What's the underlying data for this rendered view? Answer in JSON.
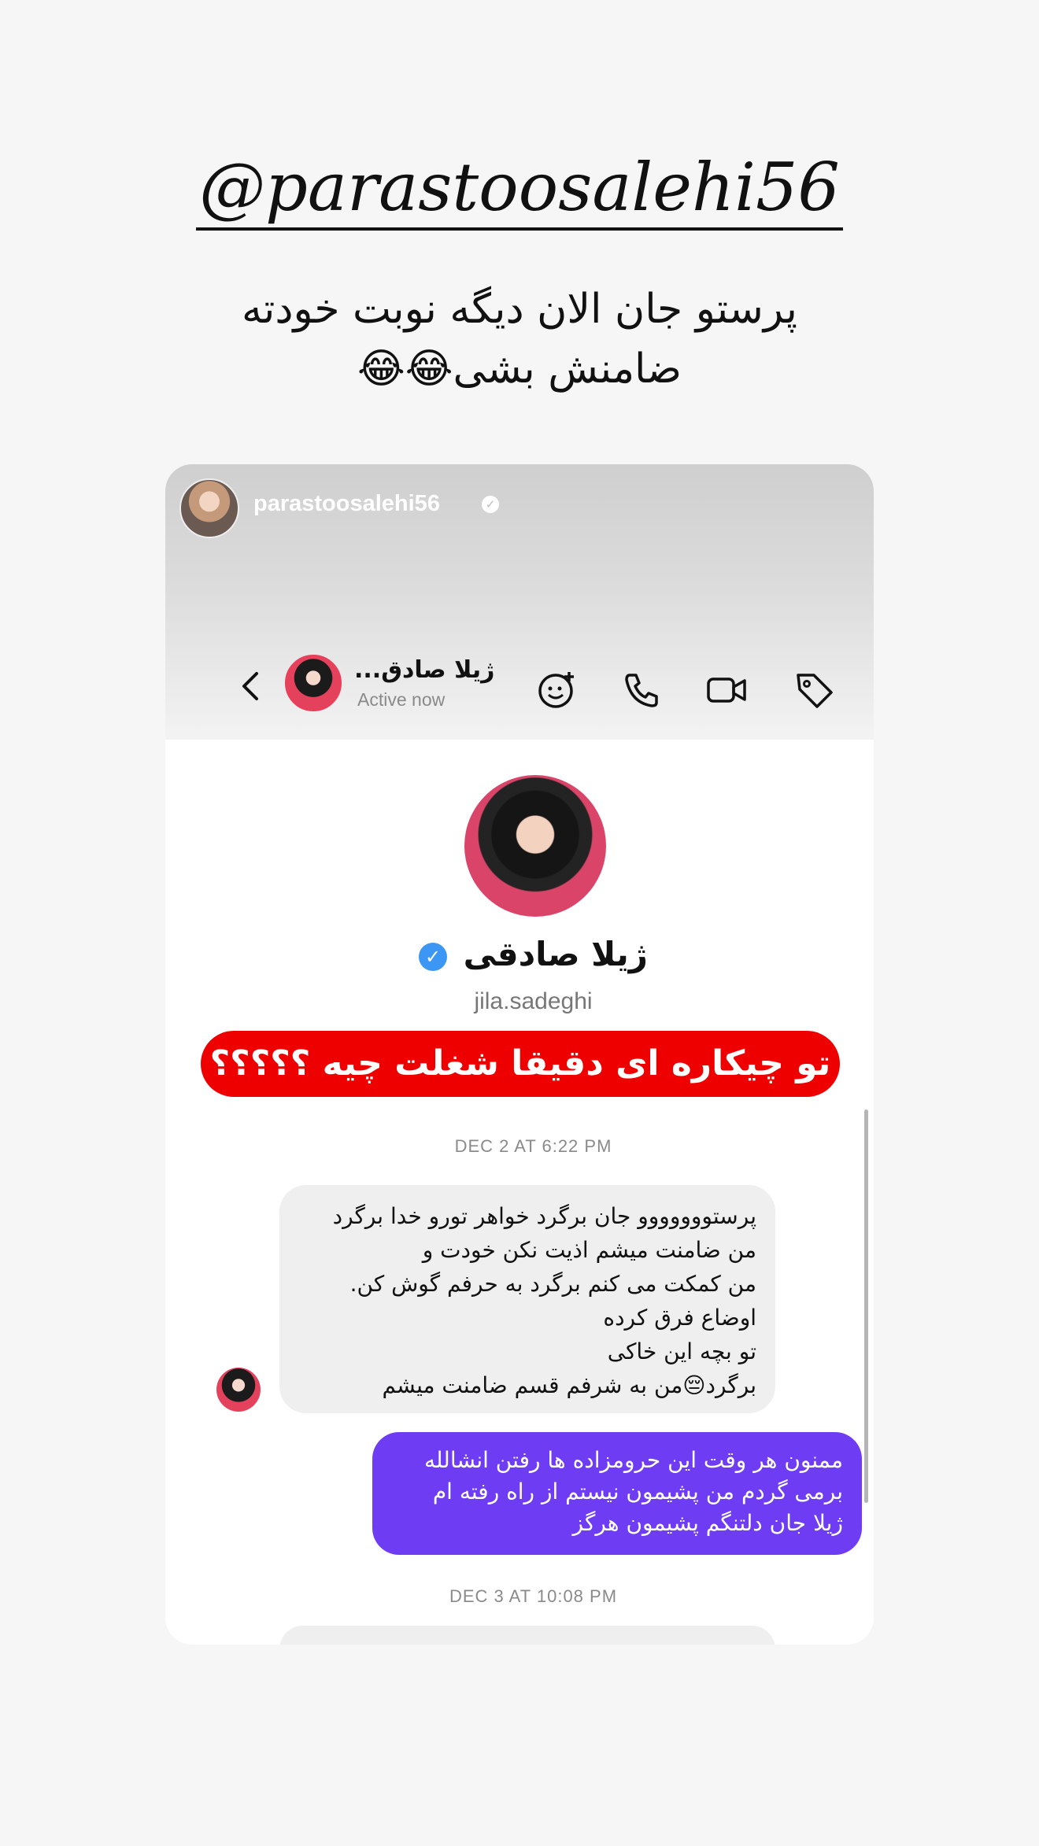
{
  "story": {
    "mention": "@parastoosalehi56",
    "caption_line1": "پرستو جان الان دیگه نوبت خودته",
    "caption_line2": "ضامنش بشی😂😂"
  },
  "shared_post": {
    "username": "parastoosalehi56",
    "verified_icon": "verified-check-icon"
  },
  "dm_header": {
    "contact_name": "ژیلا صادق...",
    "status": "Active now",
    "icons": [
      "back-chevron-icon",
      "add-sticker-icon",
      "phone-icon",
      "video-icon",
      "tag-icon"
    ]
  },
  "profile": {
    "name": "ژیلا صادقی",
    "verified_glyph": "✓",
    "handle": "jila.sadeghi"
  },
  "banner": {
    "text": "تو چیکاره ای دقیقا شغلت چیه ؟؟؟؟؟",
    "color": "#ef0000"
  },
  "messages": {
    "timestamp_1": "DEC 2 AT 6:22 PM",
    "received_lines": [
      "پرستووووووو جان برگرد خواهر تورو خدا برگرد",
      "من ضامنت میشم اذیت نکن خودت و",
      "من کمکت می کنم برگرد به حرفم گوش کن.",
      "اوضاع فرق کرده",
      "تو بچه این خاکی",
      "برگرد😔من به شرفم قسم ضامنت میشم"
    ],
    "sent_lines": [
      "ممنون هر وقت این حرومزاده ها رفتن انشالله",
      "برمی گردم من  پشیمون نیستم از راه رفته ام",
      "ژیلا جان دلتنگم پشیمون هرگز"
    ],
    "sent_color": "#6e3cf3",
    "timestamp_2": "DEC 3 AT 10:08 PM"
  }
}
